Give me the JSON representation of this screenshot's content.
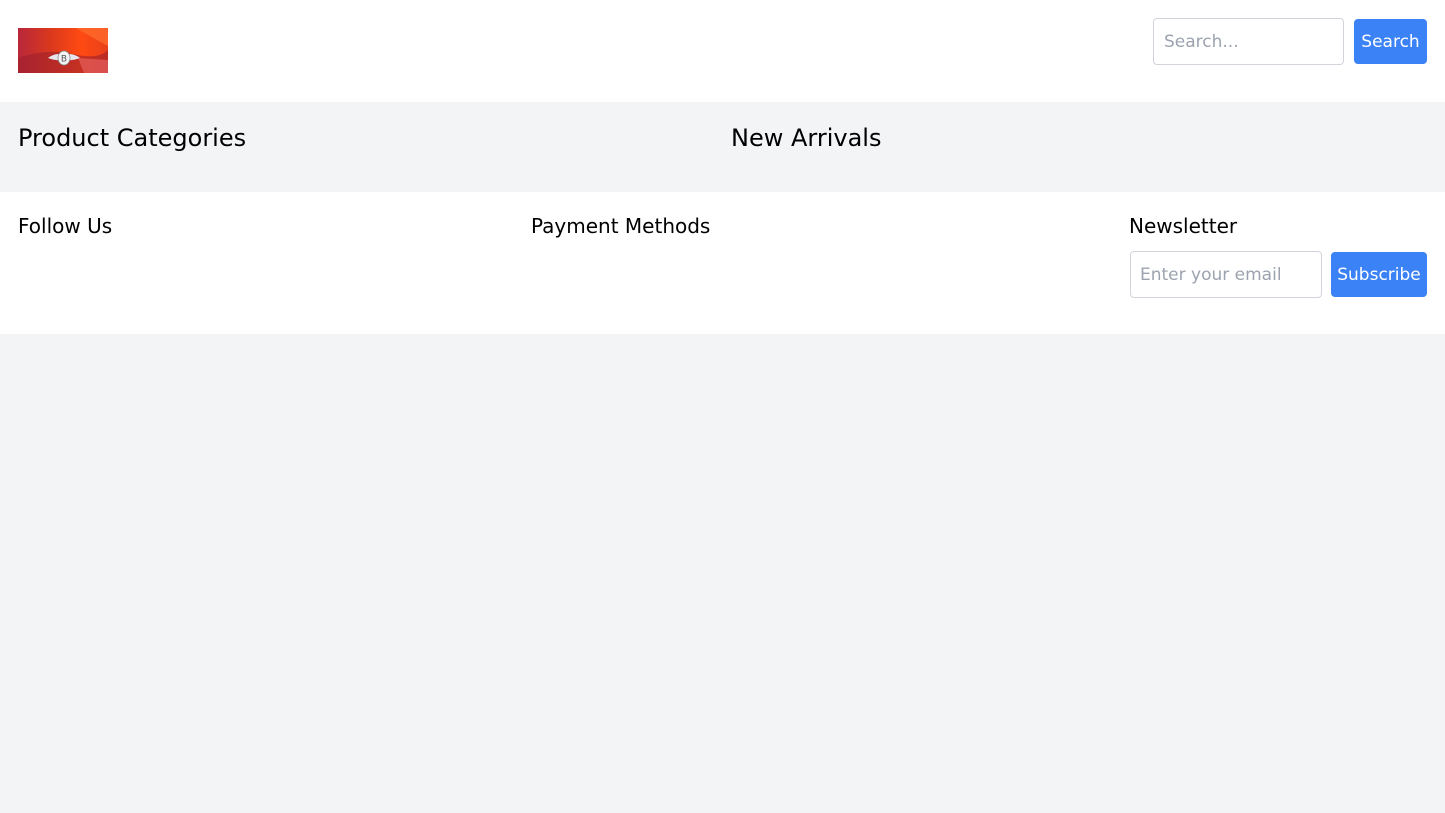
{
  "header": {
    "logo": {
      "emblem_letter": "B",
      "colors": {
        "primary": "#e8401c",
        "secondary": "#b8273a",
        "highlight": "#ff5a1f",
        "emblem": "#e6e6ee"
      }
    },
    "search": {
      "placeholder": "Search...",
      "value": "",
      "button_label": "Search"
    }
  },
  "main": {
    "sections": [
      {
        "title": "Product Categories"
      },
      {
        "title": "New Arrivals"
      }
    ]
  },
  "footer": {
    "follow_title": "Follow Us",
    "payment_title": "Payment Methods",
    "newsletter": {
      "title": "Newsletter",
      "email_placeholder": "Enter your email",
      "email_value": "",
      "button_label": "Subscribe"
    }
  },
  "colors": {
    "accent": "#3b82f6",
    "page_background": "#f3f4f6",
    "surface": "#ffffff",
    "input_border": "#d1d5db"
  }
}
